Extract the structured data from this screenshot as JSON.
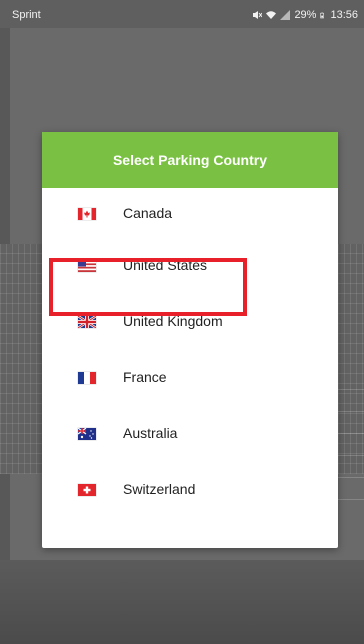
{
  "status_bar": {
    "carrier": "Sprint",
    "battery": "29%",
    "time": "13:56",
    "icons": [
      "mute-icon",
      "wifi-icon",
      "signal-icon",
      "battery-icon"
    ]
  },
  "dialog": {
    "title": "Select Parking Country",
    "header_color": "#7ac143",
    "countries": [
      {
        "label": "Canada",
        "flag": "canada-flag-icon"
      },
      {
        "label": "United States",
        "flag": "usa-flag-icon",
        "highlighted": true
      },
      {
        "label": "United Kingdom",
        "flag": "uk-flag-icon"
      },
      {
        "label": "France",
        "flag": "france-flag-icon"
      },
      {
        "label": "Australia",
        "flag": "australia-flag-icon"
      },
      {
        "label": "Switzerland",
        "flag": "switzerland-flag-icon"
      }
    ]
  },
  "highlight_color": "#e8202a"
}
